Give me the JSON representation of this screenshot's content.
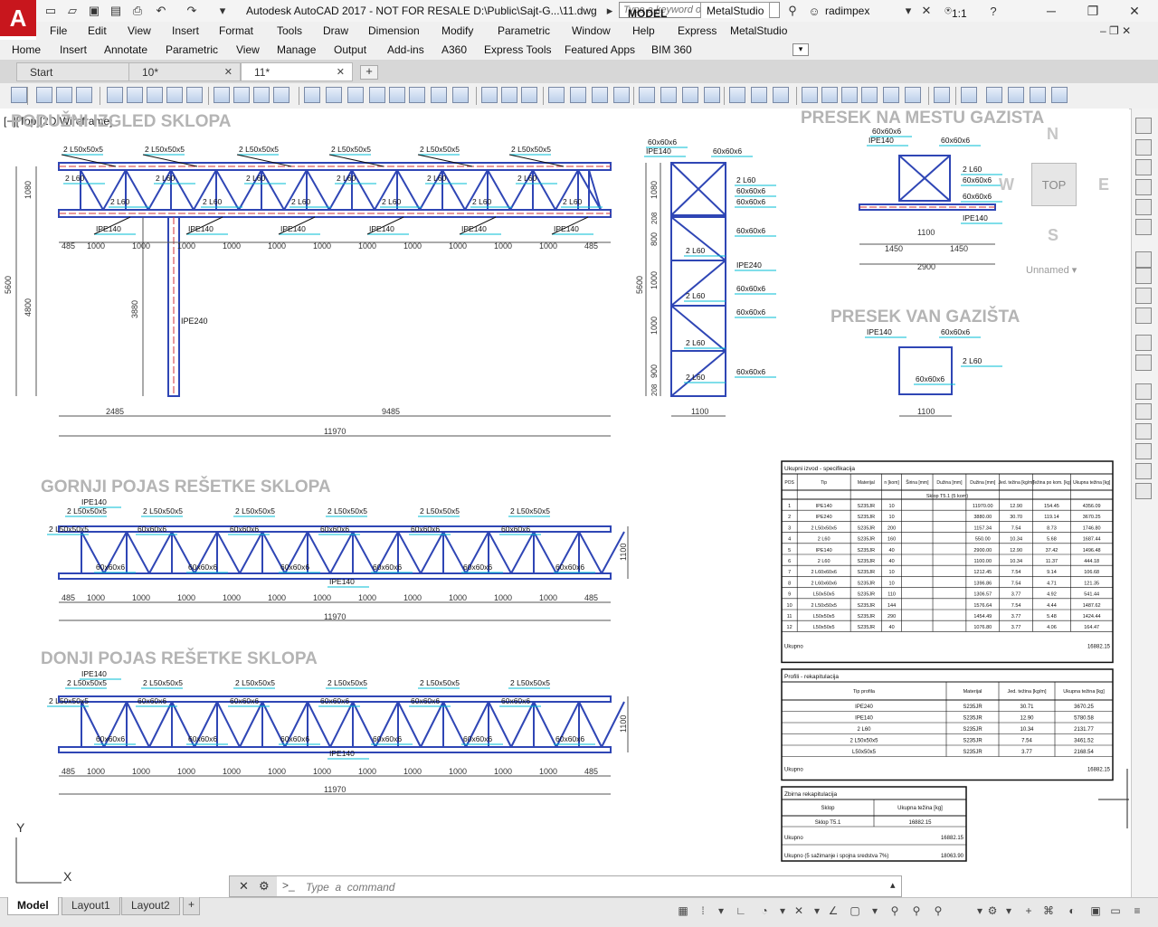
{
  "app": {
    "logo_letter": "A",
    "title": "Autodesk AutoCAD 2017 - NOT FOR RESALE    D:\\Public\\Sajt-G...\\11.dwg",
    "search_placeholder": "Type a keyword or phrase",
    "user": "radimpex"
  },
  "menu": [
    "File",
    "Edit",
    "View",
    "Insert",
    "Format",
    "Tools",
    "Draw",
    "Dimension",
    "Modify",
    "Parametric",
    "Window",
    "Help",
    "Express",
    "MetalStudio"
  ],
  "ribbon_tabs": [
    "Home",
    "Insert",
    "Annotate",
    "Parametric",
    "View",
    "Manage",
    "Output",
    "Add-ins",
    "A360",
    "Express Tools",
    "Featured Apps",
    "BIM 360",
    "MetalStudio"
  ],
  "ribbon_active": "MetalStudio",
  "file_tabs": [
    {
      "label": "Start",
      "closable": false
    },
    {
      "label": "10*",
      "closable": true
    },
    {
      "label": "11*",
      "closable": true,
      "active": true
    }
  ],
  "viewport_label": "[−][Top][2D Wireframe]",
  "viewcube": {
    "top_label": "TOP",
    "north": "N",
    "south": "S",
    "east": "E",
    "west": "W",
    "named_view": "Unnamed"
  },
  "drawing": {
    "titles": {
      "longitudinal": "PODUŽNI IZGLED SKLOPA",
      "section_walkway": "PRESEK NA MESTU GAZISTA",
      "section_outside": "PRESEK VAN GAZIŠTA",
      "top_chord": "GORNJI POJAS REŠETKE SKLOPA",
      "bottom_chord": "DONJI POJAS REŠETKE SKLOPA"
    },
    "labels": {
      "ipe140": "IPE140",
      "ipe240": "IPE240",
      "angle_50": "2 L50x50x5",
      "angle_60": "2 L60",
      "angle_60_label": "60x60x6"
    },
    "dims": {
      "span_485": "485",
      "span_1000": "1000",
      "overall": "11970",
      "left_part": "2485",
      "right_part": "9485",
      "height_5600": "5600",
      "height_4800": "4800",
      "height_1080": "1080",
      "height_3880": "3880",
      "width_1100": "1100",
      "half_1450": "1450",
      "total_2900": "2900",
      "chord_1100": "1100",
      "h_800": "800",
      "h_1000": "1000",
      "h_208": "208",
      "h_900": "900"
    }
  },
  "spec_table": {
    "title": "Ukupni izvod - specifikacija",
    "headers": [
      "POS",
      "Tip",
      "Materijal",
      "n [kom]",
      "Širina [mm]",
      "Dužina [mm]",
      "Dužina [mm]",
      "Jed. težina [kg/m]",
      "Težina po kom. [kg]",
      "Ukupna težina [kg]"
    ],
    "group": "Sklop T5.1 (5 kom)",
    "rows": [
      [
        "1",
        "IPE140",
        "S235JR",
        "10",
        "",
        "11970.00",
        "12.90",
        "154.45",
        "4356.09"
      ],
      [
        "2",
        "IPE240",
        "S235JR",
        "10",
        "",
        "3880.00",
        "30.70",
        "119.14",
        "3670.25"
      ],
      [
        "3",
        "2 L50x50x5",
        "S235JR",
        "200",
        "",
        "1157.34",
        "7.54",
        "8.73",
        "1746.80"
      ],
      [
        "4",
        "2 L60",
        "S235JR",
        "160",
        "",
        "550.00",
        "10.34",
        "5.68",
        "1687.44"
      ],
      [
        "5",
        "IPE140",
        "S235JR",
        "40",
        "",
        "2900.00",
        "12.90",
        "37.42",
        "1496.48"
      ],
      [
        "6",
        "2 L60",
        "S235JR",
        "40",
        "",
        "1100.00",
        "10.34",
        "11.37",
        "444.18"
      ],
      [
        "7",
        "2 L60x60x6",
        "S235JR",
        "10",
        "",
        "1212.45",
        "7.54",
        "9.14",
        "106.68"
      ],
      [
        "8",
        "2 L60x60x6",
        "S235JR",
        "10",
        "",
        "1396.86",
        "7.54",
        "4.71",
        "121.35"
      ],
      [
        "9",
        "L50x50x5",
        "S235JR",
        "110",
        "",
        "1306.57",
        "3.77",
        "4.92",
        "541.44"
      ],
      [
        "10",
        "2 L50x50x5",
        "S235JR",
        "144",
        "",
        "1576.64",
        "7.54",
        "4.44",
        "1487.62"
      ],
      [
        "11",
        "L50x50x5",
        "S235JR",
        "290",
        "",
        "1454.49",
        "3.77",
        "5.48",
        "1424.44"
      ],
      [
        "12",
        "L50x50x5",
        "S235JR",
        "40",
        "",
        "1076.80",
        "3.77",
        "4.06",
        "164.47"
      ]
    ],
    "total_label": "Ukupno",
    "total_value": "16882.15"
  },
  "profile_table": {
    "title": "Profili - rekapitulacija",
    "headers": [
      "Tip profila",
      "Materijal",
      "Jed. težina [kg/m]",
      "Ukupna težina [kg]"
    ],
    "rows": [
      [
        "IPE240",
        "S235JR",
        "30.71",
        "3670.25"
      ],
      [
        "IPE140",
        "S235JR",
        "12.90",
        "5780.58"
      ],
      [
        "2 L60",
        "S235JR",
        "10.34",
        "2131.77"
      ],
      [
        "2 L50x50x5",
        "S235JR",
        "7.54",
        "3461.52"
      ],
      [
        "L50x50x5",
        "S235JR",
        "3.77",
        "2168.54"
      ]
    ],
    "total_label": "Ukupno",
    "total_value": "16882.15"
  },
  "summary_table": {
    "title": "Zbirna rekapitulacija",
    "headers": [
      "Sklop",
      "Ukupna težina [kg]"
    ],
    "rows": [
      [
        "Sklop T5.1",
        "16882.15"
      ]
    ],
    "total_label": "Ukupno",
    "total_value": "16882.15",
    "grand_label": "Ukupno (5 sažimanje i spojna sredstva 7%)",
    "grand_value": "18063.90"
  },
  "command": {
    "placeholder": "Type  a  command"
  },
  "layout_tabs": [
    {
      "label": "Model",
      "active": true
    },
    {
      "label": "Layout1",
      "active": false
    },
    {
      "label": "Layout2",
      "active": false
    }
  ],
  "status": {
    "model": "MODEL",
    "scale": "1:1"
  },
  "ucs": {
    "x": "X",
    "y": "Y"
  },
  "colors": {
    "steel": "#2f46b5",
    "center": "#d1303a",
    "leader": "#00bcd4",
    "dim": "#555555",
    "title": "#b0b0b0",
    "accent": "#c8161d"
  }
}
